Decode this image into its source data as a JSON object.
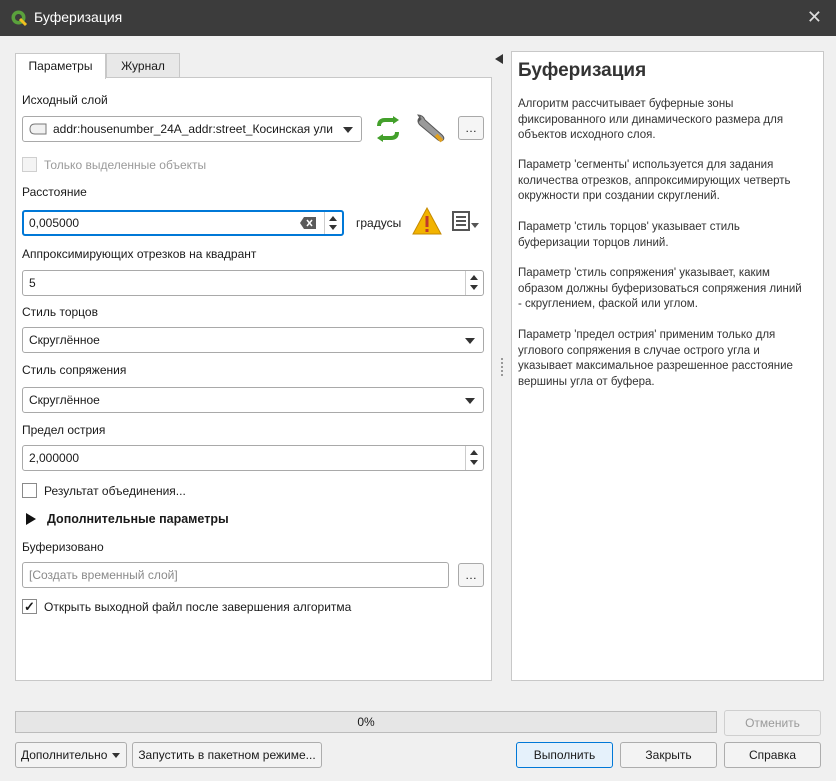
{
  "window": {
    "title": "Буферизация"
  },
  "tabs": [
    {
      "label": "Параметры"
    },
    {
      "label": "Журнал"
    }
  ],
  "params": {
    "input_layer_label": "Исходный слой",
    "input_layer_value": "addr:housenumber_24A_addr:street_Косинская ули",
    "selected_only_label": "Только выделенные объекты",
    "distance_label": "Расстояние",
    "distance_value": "0,005000",
    "distance_unit": "градусы",
    "segments_label": "Аппроксимирующих отрезков на квадрант",
    "segments_value": "5",
    "end_cap_label": "Стиль торцов",
    "end_cap_value": "Скруглённое",
    "join_label": "Стиль сопряжения",
    "join_value": "Скруглённое",
    "miter_label": "Предел острия",
    "miter_value": "2,000000",
    "dissolve_label": "Результат объединения...",
    "advanced_label": "Дополнительные параметры",
    "output_label": "Буферизовано",
    "output_placeholder": "[Создать временный слой]",
    "open_output_label": "Открыть выходной файл после завершения алгоритма",
    "dots": "…"
  },
  "help": {
    "title": "Буферизация",
    "p1": "Алгоритм рассчитывает буферные зоны фиксированного или динамического размера для объектов исходного слоя.",
    "p2": "Параметр 'сегменты' используется для задания количества отрезков, аппроксимирующих четверть окружности при создании скруглений.",
    "p3": "Параметр 'стиль торцов' указывает стиль буферизации торцов линий.",
    "p4": "Параметр 'стиль сопряжения' указывает, каким образом должны буферизоваться сопряжения линий - скруглением, фаской или углом.",
    "p5": "Параметр 'предел острия' применим только для углового сопряжения в случае острого угла и указывает максимальное разрешенное расстояние вершины угла от буфера."
  },
  "progress": {
    "percent": 0,
    "label": "0%"
  },
  "buttons": {
    "cancel": "Отменить",
    "advanced": "Дополнительно",
    "batch": "Запустить в пакетном режиме...",
    "run": "Выполнить",
    "close": "Закрыть",
    "help": "Справка"
  },
  "icons": {
    "logo": "qgis-logo-icon",
    "close": "close-icon",
    "refresh": "iterate-icon",
    "settings": "wrench-icon",
    "warning": "warning-icon",
    "data_defined": "data-defined-icon",
    "clear": "clear-icon"
  },
  "colors": {
    "titlebar": "#3c3c3c",
    "accent": "#0078d7",
    "qgis_green": "#5aa13c",
    "warning": "#f2b300"
  }
}
